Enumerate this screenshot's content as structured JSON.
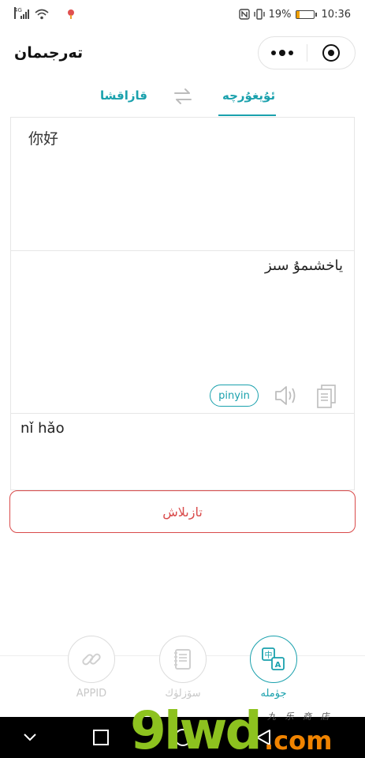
{
  "status_bar": {
    "network": "4G",
    "battery_percent": "19%",
    "battery_level": 0.19,
    "time": "10:36",
    "icons": [
      "signal-icon",
      "wifi-icon",
      "location-icon",
      "nfc-icon",
      "vibrate-icon",
      "battery-icon"
    ]
  },
  "header": {
    "title": "تەرجىمان",
    "menu_icon": "more-dots-icon",
    "close_icon": "target-icon"
  },
  "languages": {
    "source": "قازاقشا",
    "target": "ئۇيغۇرچە",
    "swap_icon": "swap-arrows-icon",
    "active_color": "#1aa1ad"
  },
  "input": {
    "text": "你好"
  },
  "output": {
    "text": "ياخشىمۇ سىز",
    "pinyin_button": "pinyin",
    "speaker_icon": "speaker-icon",
    "copy_icon": "copy-icon"
  },
  "pinyin": {
    "text": "nǐ hǎo"
  },
  "clear_button": {
    "label": "تازىلاش",
    "color": "#d94a4a"
  },
  "tabbar": {
    "tabs": [
      {
        "label": "APPID",
        "icon": "link-icon",
        "active": false
      },
      {
        "label": "سۆزلۈك",
        "icon": "notebook-icon",
        "active": false
      },
      {
        "label": "جۈملە",
        "icon": "translate-icon",
        "active": true
      }
    ]
  },
  "navbar": {
    "icons": [
      "chevron-down-icon",
      "square-icon",
      "circle-home-icon",
      "triangle-back-icon"
    ]
  },
  "watermark": {
    "mark": "9lwd",
    "domain": ".com",
    "small_text": "九 乐 商 店"
  }
}
